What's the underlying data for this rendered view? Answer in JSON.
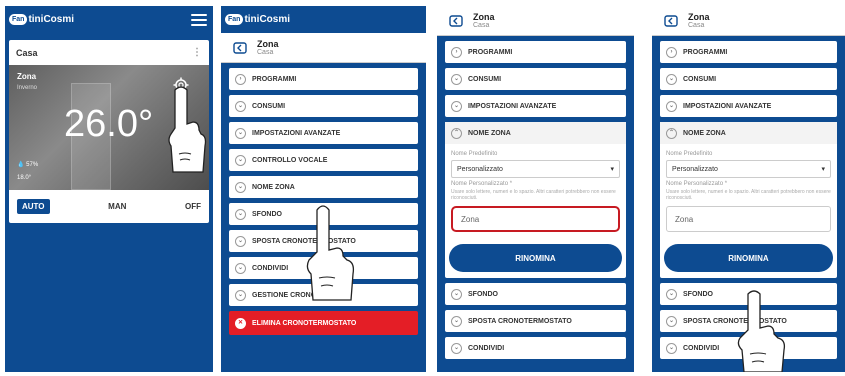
{
  "panel1": {
    "logo_badge": "Fan",
    "logo_text": "tiniCosmi",
    "card_title": "Casa",
    "zone_name": "Zona",
    "season": "Inverno",
    "temperature": "26.0°",
    "humidity": "57%",
    "external": "18.0°",
    "modes": {
      "auto": "AUTO",
      "man": "MAN",
      "off": "OFF"
    }
  },
  "header": {
    "title": "Zona",
    "subtitle": "Casa"
  },
  "panel2": {
    "items": [
      "PROGRAMMI",
      "CONSUMI",
      "IMPOSTAZIONI AVANZATE",
      "CONTROLLO VOCALE",
      "NOME ZONA",
      "SFONDO",
      "SPOSTA CRONOTERMOSTATO",
      "CONDIVIDI",
      "GESTIONE CRONO"
    ],
    "danger": "ELIMINA CRONOTERMOSTATO"
  },
  "panel3": {
    "items_top": [
      "PROGRAMMI",
      "CONSUMI",
      "IMPOSTAZIONI AVANZATE"
    ],
    "expanded_title": "NOME ZONA",
    "predef_label": "Nome Predefinito",
    "predef_value": "Personalizzato",
    "custom_label": "Nome Personalizzato *",
    "hint": "Usare solo lettere, numeri e lo spazio. Altri caratteri potrebbero non essere riconosciuti.",
    "input_value": "Zona",
    "rename": "RINOMINA",
    "items_bottom": [
      "SFONDO",
      "SPOSTA CRONOTERMOSTATO",
      "CONDIVIDI"
    ]
  },
  "panel4": {
    "items_top": [
      "PROGRAMMI",
      "CONSUMI",
      "IMPOSTAZIONI AVANZATE"
    ],
    "expanded_title": "NOME ZONA",
    "predef_label": "Nome Predefinito",
    "predef_value": "Personalizzato",
    "custom_label": "Nome Personalizzato *",
    "hint": "Usare solo lettere, numeri e lo spazio. Altri caratteri potrebbero non essere riconosciuti.",
    "input_value": "Zona",
    "rename": "RINOMINA",
    "items_bottom": [
      "SFONDO",
      "SPOSTA CRONOTERMOSTATO",
      "CONDIVIDI"
    ]
  },
  "colors": {
    "brand": "#0d4b91",
    "danger": "#e41e26",
    "highlight": "#c71a22"
  }
}
